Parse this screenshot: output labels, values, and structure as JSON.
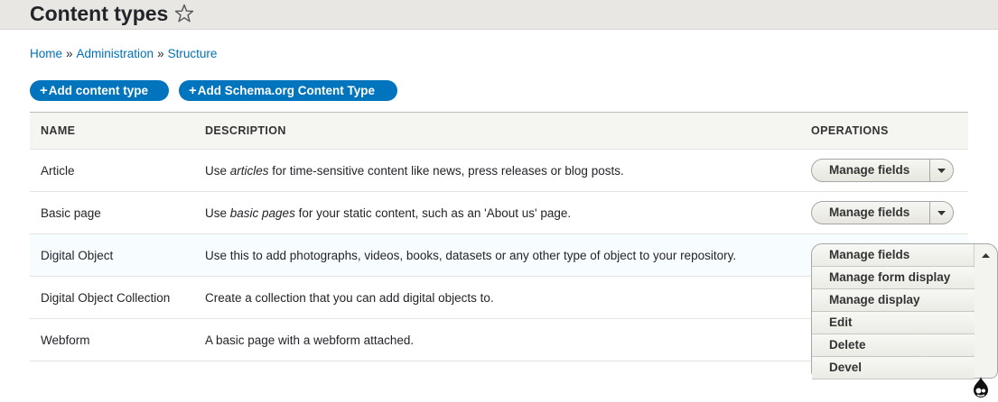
{
  "header": {
    "title": "Content types"
  },
  "breadcrumb": {
    "items": [
      "Home",
      "Administration",
      "Structure"
    ],
    "separator": "»"
  },
  "actions": {
    "add_content_type": "Add content type",
    "add_schema_type": "Add Schema.org Content Type"
  },
  "table": {
    "headers": {
      "name": "Name",
      "description": "Description",
      "operations": "Operations"
    },
    "rows": [
      {
        "name": "Article",
        "desc_pre": "Use ",
        "desc_em": "articles",
        "desc_post": " for time-sensitive content like news, press releases or blog posts.",
        "op": "Manage fields"
      },
      {
        "name": "Basic page",
        "desc_pre": "Use ",
        "desc_em": "basic pages",
        "desc_post": " for your static content, such as an 'About us' page.",
        "op": "Manage fields"
      },
      {
        "name": "Digital Object",
        "desc": "Use this to add photographs, videos, books, datasets or any other type of object to your repository."
      },
      {
        "name": "Digital Object Collection",
        "desc": "Create a collection that you can add digital objects to."
      },
      {
        "name": "Webform",
        "desc": "A basic page with a webform attached."
      }
    ]
  },
  "dropdown_open": {
    "items": [
      "Manage fields",
      "Manage form display",
      "Manage display",
      "Edit",
      "Delete",
      "Devel"
    ]
  },
  "colors": {
    "link": "#0071b8",
    "primary_button": "#0074bd",
    "header_bg": "#e8e7e3"
  }
}
